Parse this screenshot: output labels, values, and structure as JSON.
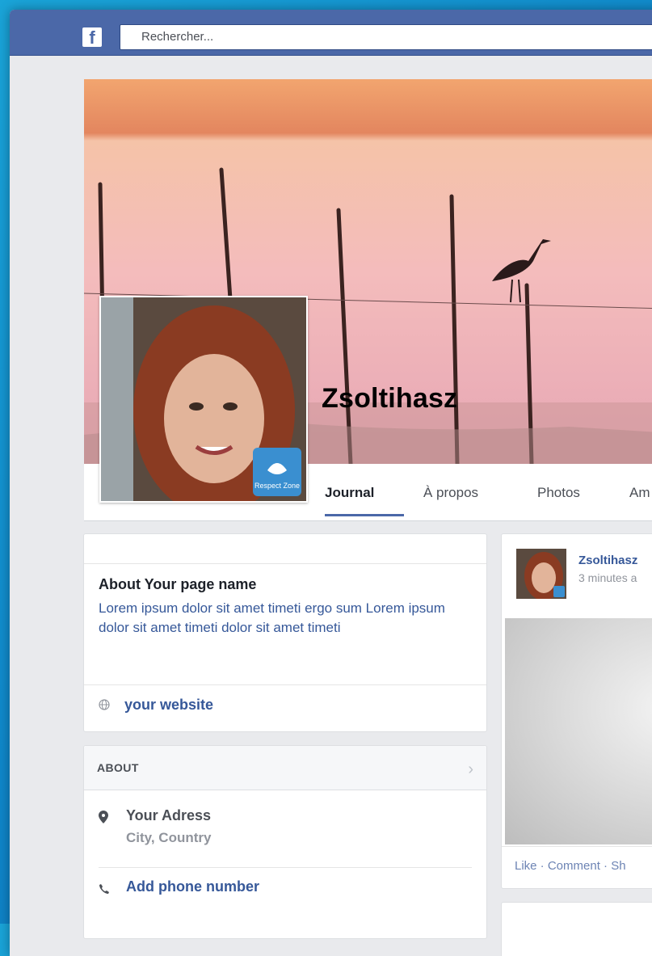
{
  "header": {
    "logo_glyph": "f",
    "search_placeholder": "Rechercher..."
  },
  "profile": {
    "name": "Zsoltihasz",
    "badge_text": "Respect Zone"
  },
  "tabs": [
    {
      "label": "Journal",
      "active": true
    },
    {
      "label": "À propos",
      "active": false
    },
    {
      "label": "Photos",
      "active": false
    },
    {
      "label": "Am",
      "active": false
    }
  ],
  "about_card": {
    "title": "About Your page name",
    "text": "Lorem ipsum dolor sit amet timeti ergo sum Lorem ipsum dolor sit amet timeti dolor sit amet timeti",
    "website": "your website"
  },
  "about_section": {
    "header": "ABOUT",
    "address": "Your Adress",
    "city": "City, Country",
    "phone": "Add phone number"
  },
  "post": {
    "author": "Zsoltihasz",
    "time": "3 minutes a",
    "actions_prefix": "Like · Comment · Sh"
  },
  "colors": {
    "brand": "#4b68a8",
    "link": "#365899",
    "background": "#e9eaed"
  }
}
